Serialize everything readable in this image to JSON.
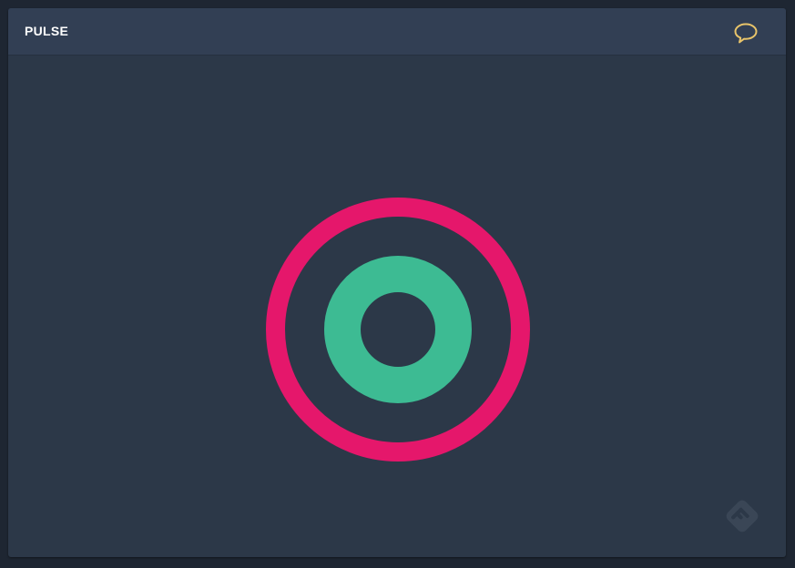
{
  "window": {
    "title": "PULSE"
  },
  "icons": {
    "chat": "speech-bubble-icon",
    "brand": "feedly-logo-icon"
  },
  "colors": {
    "background": "#2c3848",
    "titlebar": "#323f54",
    "outer_ring": "#e5176b",
    "inner_ring": "#3dbb93",
    "chat_icon": "#e8c46a",
    "logo": "#3a4656"
  }
}
